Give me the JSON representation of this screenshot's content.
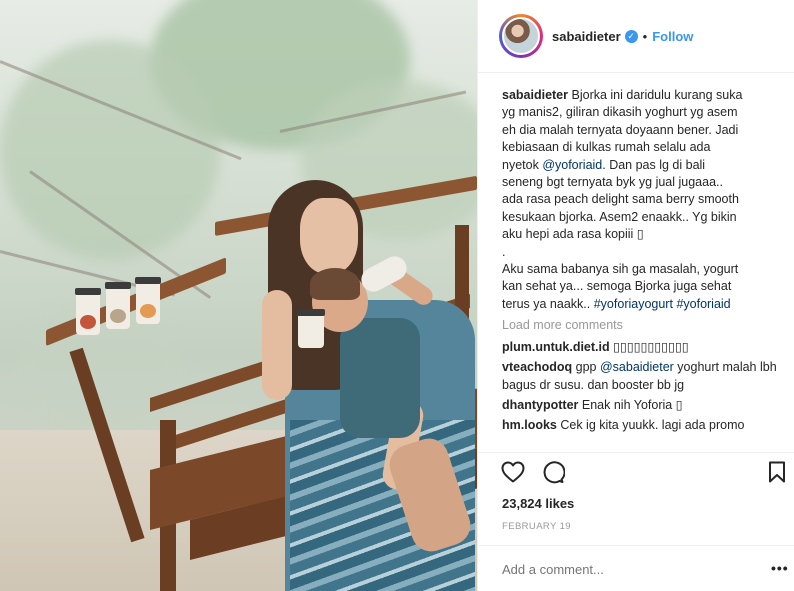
{
  "post": {
    "username": "sabaidieter",
    "verified_glyph": "✓",
    "separator": "•",
    "follow_label": "Follow"
  },
  "caption": {
    "user": "sabaidieter",
    "lines": [
      "Bjorka ini daridulu kurang suka",
      "yg manis2, giliran dikasih yoghurt yg asem",
      "eh dia malah ternyata doyaann bener. Jadi",
      "kebiasaan di kulkas rumah selalu ada",
      "Dan pas lg di bali",
      "seneng bgt ternyata byk yg jual jugaaa..",
      "ada rasa peach delight sama berry smooth",
      "kesukaan bjorka. Asem2 enaakk.. Yg bikin",
      "aku hepi ada rasa kopiii ",
      ".",
      "Aku sama babanya sih ga masalah, yogurt",
      "kan sehat ya... semoga Bjorka juga sehat",
      "terus ya naakk.."
    ],
    "line4_prefix": "nyetok ",
    "mention": "@yoforiaid",
    "line4_suffix": ". Dan pas lg di bali",
    "hashtag1": "#yoforiayogurt",
    "hashtag2": "#yoforiaid",
    "glyph_box": "▯"
  },
  "load_more_label": "Load more comments",
  "comments": [
    {
      "user": "plum.untuk.diet.id",
      "text": "▯▯▯▯▯▯▯▯▯▯▯"
    },
    {
      "user": "vteachodoq",
      "prefix": "gpp ",
      "mention": "@sabaidieter",
      "text": " yoghurt malah lbh bagus dr susu. dan booster bb jg"
    },
    {
      "user": "dhantypotter",
      "text": "Enak nih Yoforia ▯"
    },
    {
      "user": "hm.looks",
      "text": "Cek ig kita yuukk. lagi ada promo"
    }
  ],
  "actions": {
    "like_icon": "heart-icon",
    "comment_icon": "comment-icon",
    "save_icon": "bookmark-icon"
  },
  "likes_text": "23,824 likes",
  "date_text": "FEBRUARY 19",
  "add_comment_placeholder": "Add a comment...",
  "more_label": "•••",
  "colors": {
    "link_blue": "#3897f0",
    "mention_navy": "#003569",
    "muted_gray": "#999999",
    "text": "#262626"
  }
}
